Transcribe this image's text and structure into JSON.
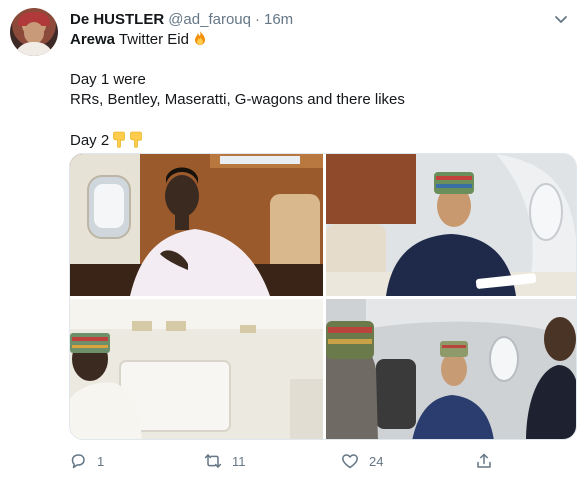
{
  "tweet": {
    "name": "De HUSTLER",
    "handle": "@ad_farouq",
    "separator": "·",
    "time": "16m",
    "line1_bold": "Arewa",
    "line1_rest": " Twitter Eid",
    "line2": "Day 1 were",
    "line3": "RRs, Bentley, Maseratti, G-wagons and there likes",
    "line4": "Day 2"
  },
  "actions": {
    "reply_count": "1",
    "retweet_count": "11",
    "like_count": "24"
  },
  "icons": {
    "reply": "reply-icon",
    "retweet": "retweet-icon",
    "like": "heart-icon",
    "share": "share-icon",
    "fire": "fire-emoji",
    "hand": "pointing-down-emoji"
  },
  "colors": {
    "text": "#14171a",
    "muted": "#657786",
    "border": "#e1e8ed"
  }
}
